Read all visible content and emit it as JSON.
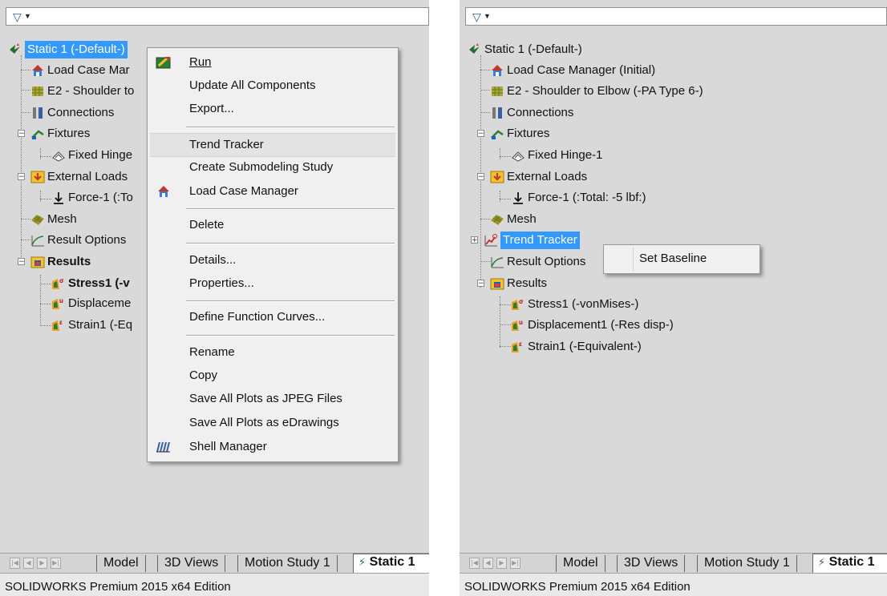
{
  "filter": {
    "icon": "filter-funnel-icon"
  },
  "left_tree": {
    "items": [
      {
        "label": "Static 1 (-Default-)",
        "icon": "static-study-icon"
      },
      {
        "label": "Load Case Mar",
        "icon": "load-case-manager-icon"
      },
      {
        "label": "E2 - Shoulder to",
        "icon": "part-icon"
      },
      {
        "label": "Connections",
        "icon": "connections-icon"
      },
      {
        "label": "Fixtures",
        "icon": "fixtures-icon"
      },
      {
        "label": "Fixed Hinge",
        "icon": "fixed-hinge-icon"
      },
      {
        "label": "External Loads",
        "icon": "external-loads-icon"
      },
      {
        "label": "Force-1 (:To",
        "icon": "force-arrow-icon"
      },
      {
        "label": "Mesh",
        "icon": "mesh-icon"
      },
      {
        "label": "Result Options",
        "icon": "result-options-icon"
      },
      {
        "label": "Results",
        "icon": "results-folder-icon"
      },
      {
        "label": "Stress1 (-v",
        "icon": "stress-plot-icon"
      },
      {
        "label": "Displaceme",
        "icon": "displacement-plot-icon"
      },
      {
        "label": "Strain1 (-Eq",
        "icon": "strain-plot-icon"
      }
    ]
  },
  "context_menu": {
    "run": "Run",
    "update_all": "Update All Components",
    "export": "Export...",
    "trend_tracker": "Trend Tracker",
    "create_submodeling": "Create Submodeling Study",
    "load_case_manager": "Load Case Manager",
    "delete": "Delete",
    "details": "Details...",
    "properties": "Properties...",
    "define_function_curves": "Define Function Curves...",
    "rename": "Rename",
    "copy": "Copy",
    "save_jpeg": "Save All Plots as JPEG Files",
    "save_edrawings": "Save All Plots as eDrawings",
    "shell_manager": "Shell Manager"
  },
  "right_tree": {
    "items": [
      {
        "label": "Static 1 (-Default-)"
      },
      {
        "label": "Load Case Manager (Initial)"
      },
      {
        "label": "E2 - Shoulder to Elbow (-PA Type 6-)"
      },
      {
        "label": "Connections"
      },
      {
        "label": "Fixtures"
      },
      {
        "label": "Fixed Hinge-1"
      },
      {
        "label": "External Loads"
      },
      {
        "label": "Force-1 (:Total: -5 lbf:)"
      },
      {
        "label": "Mesh"
      },
      {
        "label": "Trend Tracker"
      },
      {
        "label": "Result Options"
      },
      {
        "label": "Results"
      },
      {
        "label": "Stress1 (-vonMises-)"
      },
      {
        "label": "Displacement1 (-Res disp-)"
      },
      {
        "label": "Strain1 (-Equivalent-)"
      }
    ]
  },
  "trend_menu": {
    "set_baseline": "Set Baseline"
  },
  "tabs": {
    "model": "Model",
    "views3d": "3D Views",
    "motion": "Motion Study 1",
    "static": "Static 1"
  },
  "status": {
    "text": "SOLIDWORKS Premium 2015 x64 Edition"
  },
  "colors": {
    "selection": "#3399ff",
    "panel": "#d9d9d9",
    "menu": "#f0f0f0"
  }
}
